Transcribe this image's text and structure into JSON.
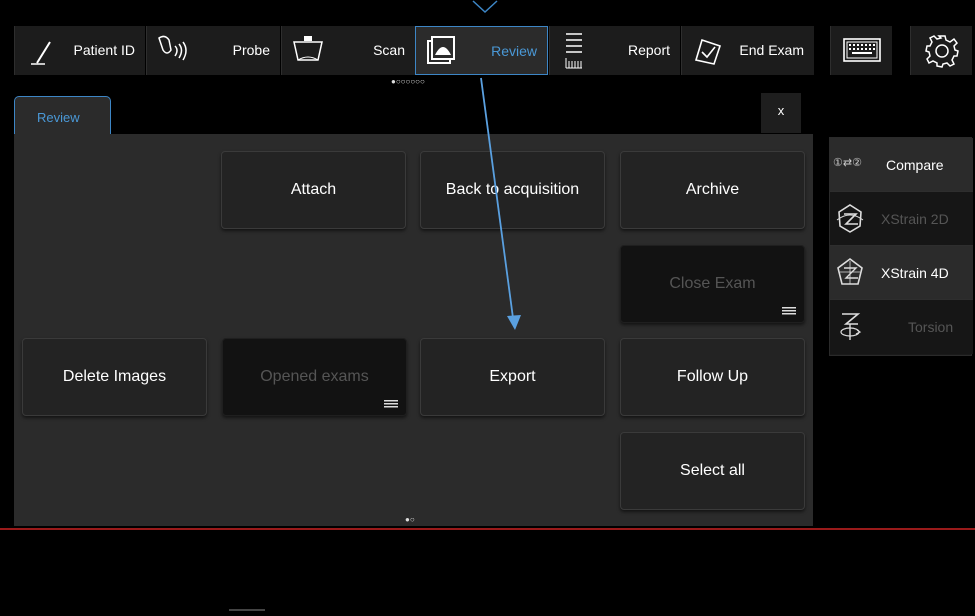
{
  "nav": {
    "patient_id": "Patient ID",
    "probe": "Probe",
    "scan": "Scan",
    "review": "Review",
    "report": "Report",
    "end_exam": "End Exam",
    "page_dots": "●○○○○○○"
  },
  "panel": {
    "tab_label": "Review",
    "close_label": "x",
    "attach": "Attach",
    "back_to_acquisition": "Back to acquisition",
    "archive": "Archive",
    "close_exam": "Close Exam",
    "delete_images": "Delete Images",
    "opened_exams": "Opened exams",
    "export": "Export",
    "follow_up": "Follow Up",
    "select_all": "Select all",
    "page_dots": "●○"
  },
  "side": {
    "compare_icon_text": "①⇄②",
    "compare": "Compare",
    "xstrain_2d": "XStrain 2D",
    "xstrain_4d": "XStrain 4D",
    "torsion": "Torsion"
  },
  "colors": {
    "accent": "#4a98d6",
    "arrow": "#5aa0e0",
    "separator_red": "#9a1a1a"
  }
}
